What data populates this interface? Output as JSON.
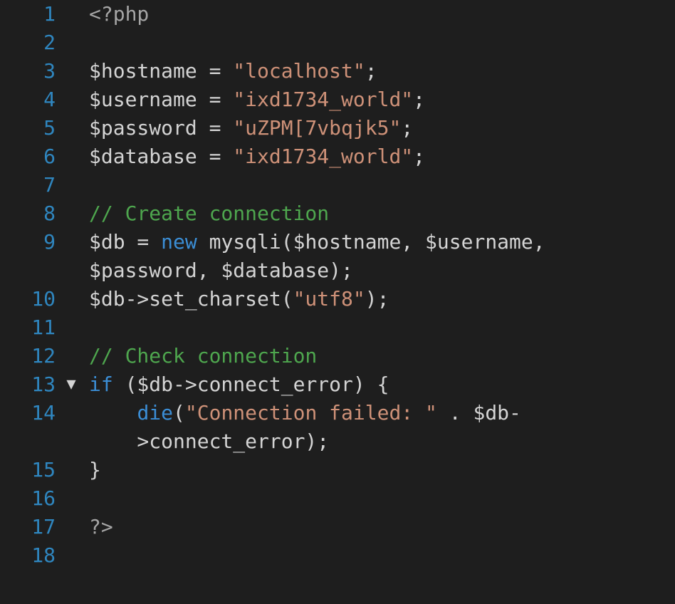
{
  "editor": {
    "language": "php",
    "colors": {
      "background": "#1e1e1e",
      "line_number": "#2f86bf",
      "text": "#d4d4d4",
      "string": "#ce9178",
      "comment": "#4ea64e",
      "keyword": "#3b8ed6"
    },
    "fold_icon": "triangle-down-icon",
    "lines": [
      {
        "num": "1",
        "fold": "",
        "tokens": [
          {
            "t": "<?php",
            "c": "tag"
          }
        ]
      },
      {
        "num": "2",
        "fold": "",
        "tokens": []
      },
      {
        "num": "3",
        "fold": "",
        "tokens": [
          {
            "t": "$hostname = ",
            "c": "plain"
          },
          {
            "t": "\"localhost\"",
            "c": "string"
          },
          {
            "t": ";",
            "c": "plain"
          }
        ]
      },
      {
        "num": "4",
        "fold": "",
        "tokens": [
          {
            "t": "$username = ",
            "c": "plain"
          },
          {
            "t": "\"ixd1734_world\"",
            "c": "string"
          },
          {
            "t": ";",
            "c": "plain"
          }
        ]
      },
      {
        "num": "5",
        "fold": "",
        "tokens": [
          {
            "t": "$password = ",
            "c": "plain"
          },
          {
            "t": "\"uZPM[7vbqjk5\"",
            "c": "string"
          },
          {
            "t": ";",
            "c": "plain"
          }
        ]
      },
      {
        "num": "6",
        "fold": "",
        "tokens": [
          {
            "t": "$database = ",
            "c": "plain"
          },
          {
            "t": "\"ixd1734_world\"",
            "c": "string"
          },
          {
            "t": ";",
            "c": "plain"
          }
        ]
      },
      {
        "num": "7",
        "fold": "",
        "tokens": []
      },
      {
        "num": "8",
        "fold": "",
        "tokens": [
          {
            "t": "// Create connection",
            "c": "comment"
          }
        ]
      },
      {
        "num": "9",
        "fold": "",
        "tokens": [
          {
            "t": "$db = ",
            "c": "plain"
          },
          {
            "t": "new",
            "c": "keyword"
          },
          {
            "t": " mysqli($hostname, $username,",
            "c": "plain"
          }
        ]
      },
      {
        "num": "",
        "fold": "",
        "tokens": [
          {
            "t": "$password, $database);",
            "c": "plain"
          }
        ]
      },
      {
        "num": "10",
        "fold": "",
        "tokens": [
          {
            "t": "$db->set_charset(",
            "c": "plain"
          },
          {
            "t": "\"utf8\"",
            "c": "string"
          },
          {
            "t": ");",
            "c": "plain"
          }
        ]
      },
      {
        "num": "11",
        "fold": "",
        "tokens": []
      },
      {
        "num": "12",
        "fold": "",
        "tokens": [
          {
            "t": "// Check connection",
            "c": "comment"
          }
        ]
      },
      {
        "num": "13",
        "fold": "▼",
        "tokens": [
          {
            "t": "if",
            "c": "keyword"
          },
          {
            "t": " ($db->connect_error) {",
            "c": "plain"
          }
        ]
      },
      {
        "num": "14",
        "fold": "",
        "tokens": [
          {
            "t": "    ",
            "c": "plain"
          },
          {
            "t": "die",
            "c": "keyword"
          },
          {
            "t": "(",
            "c": "plain"
          },
          {
            "t": "\"Connection failed: \"",
            "c": "string"
          },
          {
            "t": " . $db-",
            "c": "plain"
          }
        ]
      },
      {
        "num": "",
        "fold": "",
        "tokens": [
          {
            "t": "    >connect_error);",
            "c": "plain"
          }
        ]
      },
      {
        "num": "15",
        "fold": "",
        "tokens": [
          {
            "t": "}",
            "c": "plain"
          }
        ]
      },
      {
        "num": "16",
        "fold": "",
        "tokens": []
      },
      {
        "num": "17",
        "fold": "",
        "tokens": [
          {
            "t": "?>",
            "c": "tag"
          }
        ]
      },
      {
        "num": "18",
        "fold": "",
        "tokens": []
      }
    ]
  }
}
